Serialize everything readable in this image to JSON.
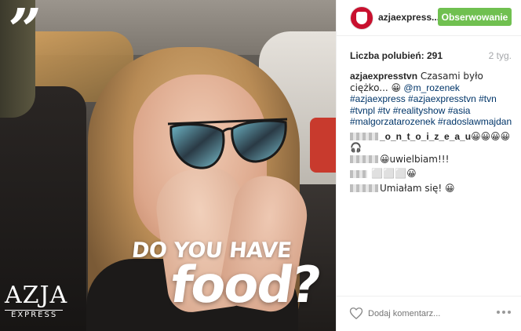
{
  "post": {
    "overlay_quote": "”",
    "caption_line_1": "DO YOU HAVE",
    "caption_line_2": "food?",
    "logo_main": "AZJA",
    "logo_sub": "EXPRESS"
  },
  "header": {
    "username": "azjaexpress...",
    "follow_label": "Obserwowanie",
    "follow_color": "#70c050"
  },
  "stats": {
    "likes_label": "Liczba polubień: ",
    "likes_count": "291",
    "time": "2 tyg."
  },
  "caption": {
    "user": "azjaexpresstvn",
    "text": " Czasami było ciężko... 😀",
    "tags": "@m_rozenek #azjaexpress #azjaexpresstvn #tvn #tvnpl #tv #realityshow #asia #malgorzatarozenek #radoslawmajdan"
  },
  "comments": [
    {
      "user": "_o_n_t_o_i_z_e_a_u",
      "text": "😀😀😀😀🎧"
    },
    {
      "user": "",
      "text": "😀uwielbiam!!!"
    },
    {
      "user": "",
      "text": "⬜⬜⬜😀"
    },
    {
      "user": "",
      "text": "Umiałam się! 😀"
    }
  ],
  "footer": {
    "comment_placeholder": "Dodaj komentarz..."
  },
  "icons": {
    "heart": "heart-icon",
    "more": "more-options-icon",
    "avatar": "profile-avatar"
  },
  "colors": {
    "link": "#003569",
    "muted": "#a5a7aa",
    "brand_red": "#c8102e"
  }
}
